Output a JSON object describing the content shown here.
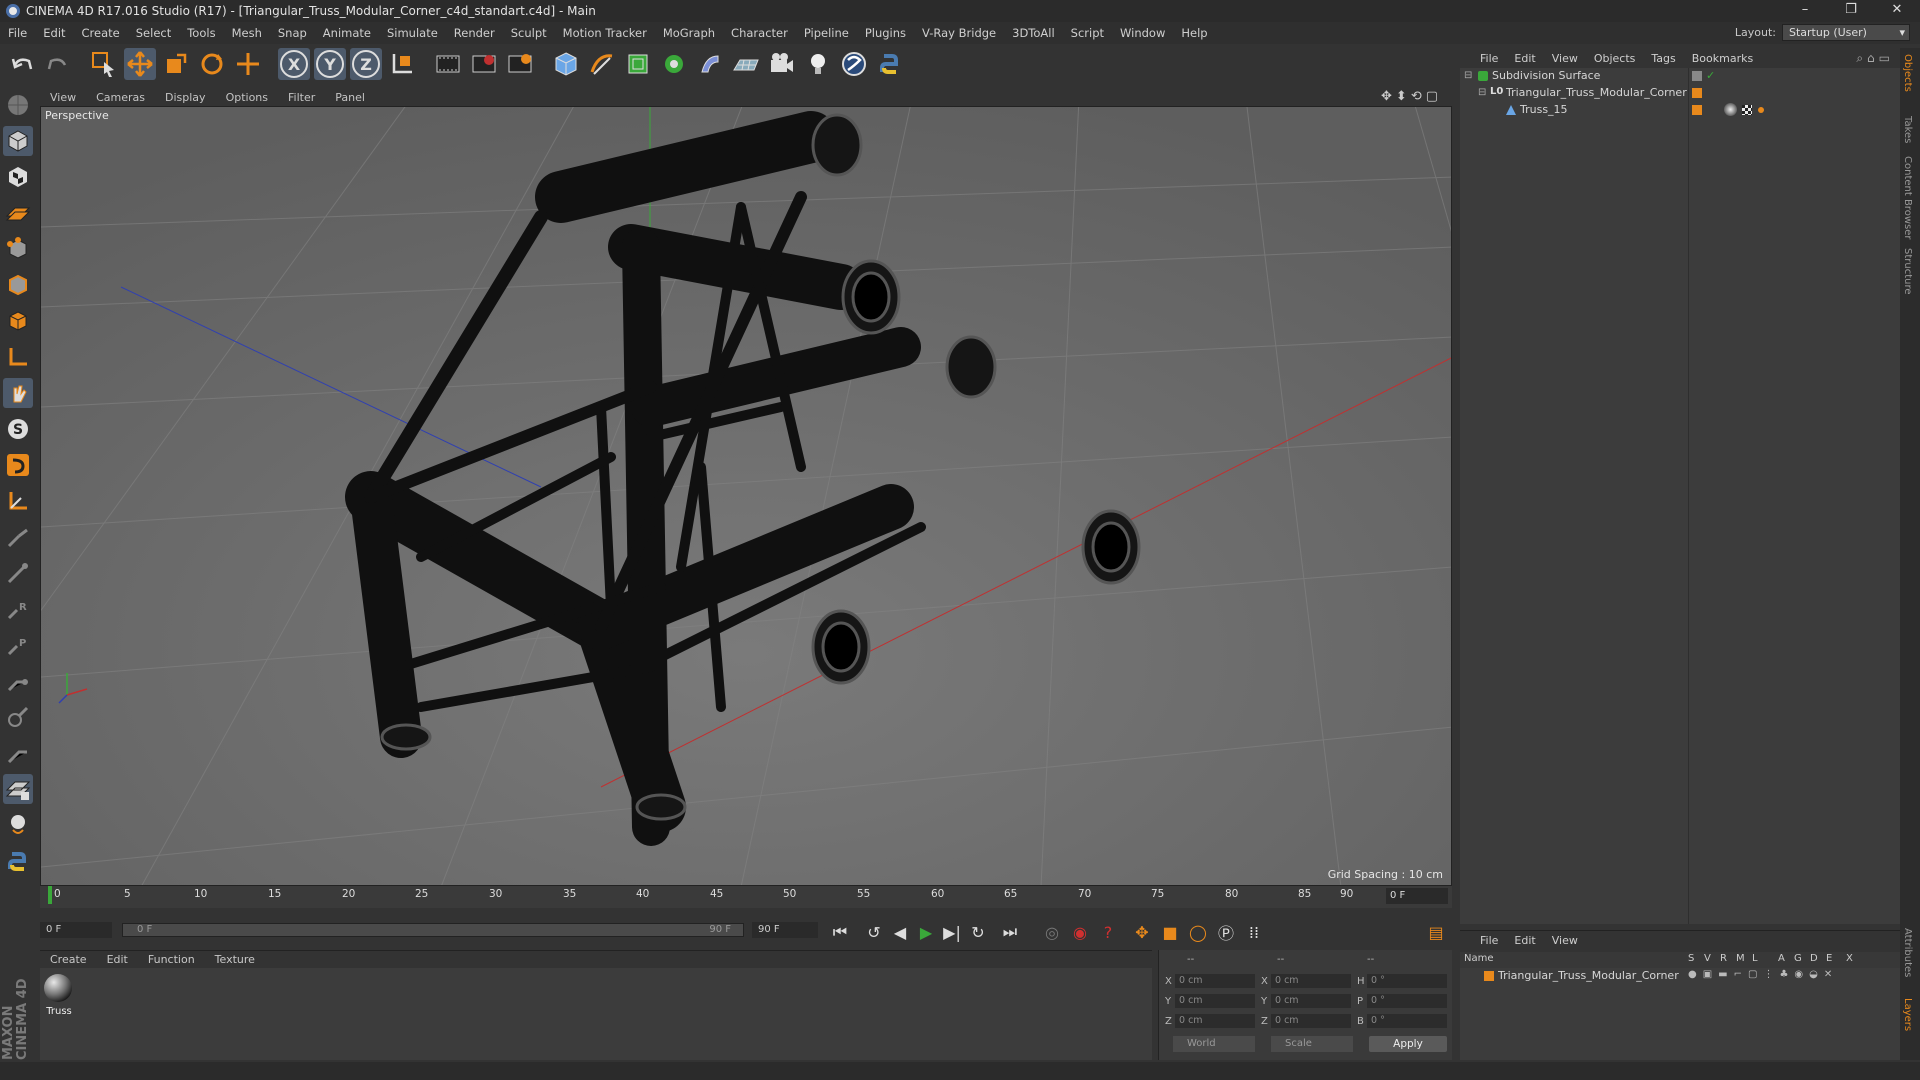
{
  "window": {
    "title": "CINEMA 4D R17.016 Studio (R17) - [Triangular_Truss_Modular_Corner_c4d_standart.c4d] - Main",
    "controls": [
      "–",
      "❐",
      "✕"
    ]
  },
  "menubar": {
    "items": [
      "File",
      "Edit",
      "Create",
      "Select",
      "Tools",
      "Mesh",
      "Snap",
      "Animate",
      "Simulate",
      "Render",
      "Sculpt",
      "Motion Tracker",
      "MoGraph",
      "Character",
      "Pipeline",
      "Plugins",
      "V-Ray Bridge",
      "3DToAll",
      "Script",
      "Window",
      "Help"
    ],
    "layout_label": "Layout:",
    "layout_value": "Startup (User)"
  },
  "viewport": {
    "menu": [
      "View",
      "Cameras",
      "Display",
      "Options",
      "Filter",
      "Panel"
    ],
    "label": "Perspective",
    "grid_spacing": "Grid Spacing : 10 cm"
  },
  "timeline": {
    "ticks": [
      "0",
      "5",
      "10",
      "15",
      "20",
      "25",
      "30",
      "35",
      "40",
      "45",
      "50",
      "55",
      "60",
      "65",
      "70",
      "75",
      "80",
      "85",
      "90"
    ],
    "current_frame": "0 F"
  },
  "transport": {
    "start_field": "0 F",
    "range_start": "0 F",
    "range_end": "90 F",
    "end_field": "90 F"
  },
  "material_manager": {
    "menu": [
      "Create",
      "Edit",
      "Function",
      "Texture"
    ],
    "materials": [
      {
        "name": "Truss"
      }
    ]
  },
  "coordinates": {
    "header_a": "--",
    "header_b": "--",
    "header_c": "--",
    "rows": [
      {
        "l1": "X",
        "v1": "0 cm",
        "l2": "X",
        "v2": "0 cm",
        "l3": "H",
        "v3": "0 °"
      },
      {
        "l1": "Y",
        "v1": "0 cm",
        "l2": "Y",
        "v2": "0 cm",
        "l3": "P",
        "v3": "0 °"
      },
      {
        "l1": "Z",
        "v1": "0 cm",
        "l2": "Z",
        "v2": "0 cm",
        "l3": "B",
        "v3": "0 °"
      }
    ],
    "mode": "World",
    "scale": "Scale",
    "apply": "Apply"
  },
  "object_manager": {
    "menu": [
      "File",
      "Edit",
      "View",
      "Objects",
      "Tags",
      "Bookmarks"
    ],
    "objects": [
      {
        "name": "Subdivision Surface"
      },
      {
        "name": "Triangular_Truss_Modular_Corner"
      },
      {
        "name": "Truss_15"
      }
    ]
  },
  "layer_manager": {
    "menu": [
      "File",
      "Edit",
      "View"
    ],
    "columns": [
      "Name",
      "S",
      "V",
      "R",
      "M",
      "L",
      "A",
      "G",
      "D",
      "E",
      "X"
    ],
    "layers": [
      {
        "name": "Triangular_Truss_Modular_Corner"
      }
    ]
  },
  "right_tabs": [
    "Objects",
    "Takes",
    "Content Browser",
    "Structure",
    "Attributes",
    "Layers"
  ],
  "brand": {
    "line1": "MAXON",
    "line2": "CINEMA 4D"
  },
  "colors": {
    "accent_orange": "#e8891c",
    "selection_blue": "#4d5a6b",
    "axis_green": "#3aa83a",
    "axis_red": "#c03030",
    "axis_blue": "#3040b0"
  }
}
